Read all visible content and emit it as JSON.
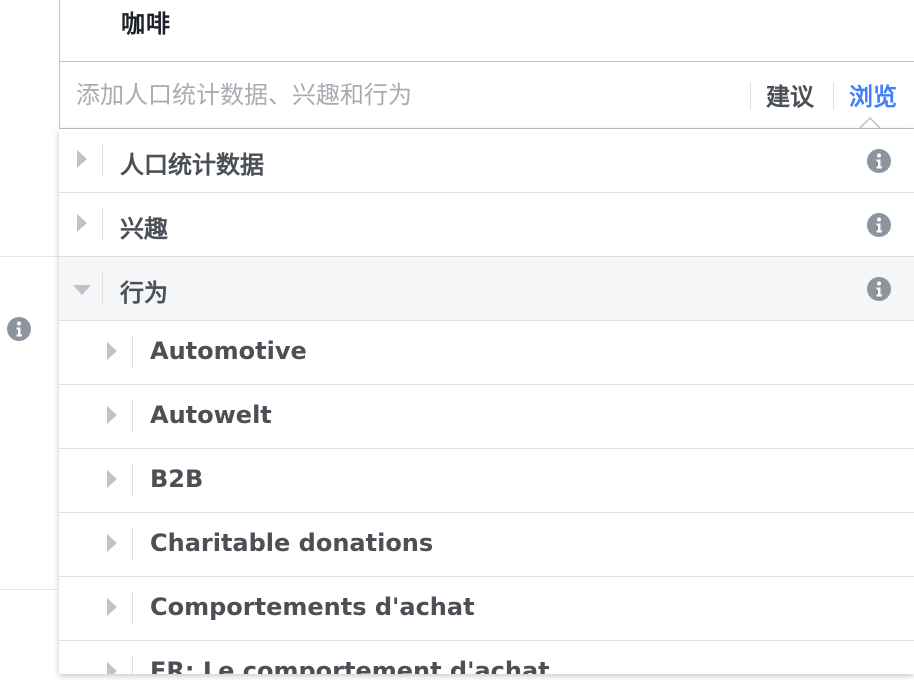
{
  "selected": {
    "tag": "咖啡"
  },
  "search": {
    "placeholder": "添加人口统计数据、兴趣和行为",
    "value": "",
    "suggest_label": "建议",
    "browse_label": "浏览"
  },
  "categories": [
    {
      "label": "人口统计数据",
      "expanded": false,
      "icon": "info-icon"
    },
    {
      "label": "兴趣",
      "expanded": false,
      "icon": "info-icon"
    },
    {
      "label": "行为",
      "expanded": true,
      "icon": "info-icon"
    }
  ],
  "subcategories": [
    {
      "label": "Automotive"
    },
    {
      "label": "Autowelt"
    },
    {
      "label": "B2B"
    },
    {
      "label": "Charitable donations"
    },
    {
      "label": "Comportements d'achat"
    },
    {
      "label": "FR: Le comportement d'achat"
    }
  ],
  "colors": {
    "accent": "#4080ff",
    "text": "#4b4f56",
    "border": "#dddfe2",
    "icon": "#8d949e",
    "expanded_bg": "#f5f6f7"
  }
}
